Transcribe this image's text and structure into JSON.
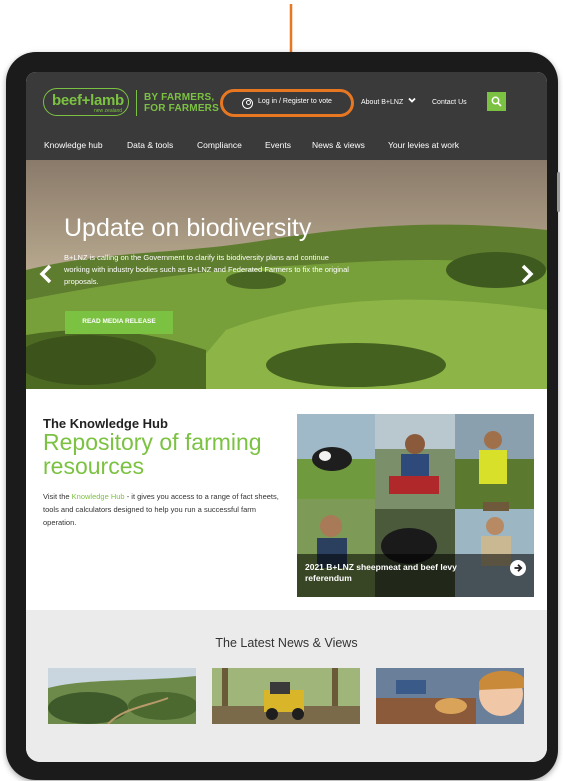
{
  "header": {
    "logo_main": "beef+lamb",
    "logo_sub": "new zealand",
    "tagline_line1": "BY FARMERS,",
    "tagline_line2": "FOR FARMERS",
    "login_label": "Log in / Register to vote",
    "about_label": "About B+LNZ",
    "contact_label": "Contact Us"
  },
  "nav": {
    "items": [
      "Knowledge hub",
      "Data & tools",
      "Compliance",
      "Events",
      "News & views",
      "Your levies at work"
    ]
  },
  "hero": {
    "title": "Update on biodiversity",
    "body": "B+LNZ is calling on the Government to clarify its biodiversity plans and continue working with industry bodies such as B+LNZ and Federated Farmers to fix the original proposals.",
    "button_label": "READ MEDIA RELEASE"
  },
  "knowledge_hub": {
    "heading": "The Knowledge Hub",
    "title": "Repository of farming resources",
    "body_prefix": "Visit the ",
    "body_link": "Knowledge Hub",
    "body_suffix": " - it gives you access to a range of fact sheets, tools and calculators designed to help you run a successful farm operation.",
    "card_text": "2021 B+LNZ sheepmeat and beef levy referendum"
  },
  "news": {
    "title": "The Latest News & Views"
  },
  "colors": {
    "brand_green": "#7cc242",
    "header_bg": "#3a3a3a",
    "highlight_orange": "#e87722"
  },
  "icons": [
    "down-arrow-annotation-icon",
    "user-icon",
    "chevron-down-icon",
    "search-icon",
    "chevron-left-icon",
    "chevron-right-icon",
    "arrow-circle-right-icon"
  ]
}
